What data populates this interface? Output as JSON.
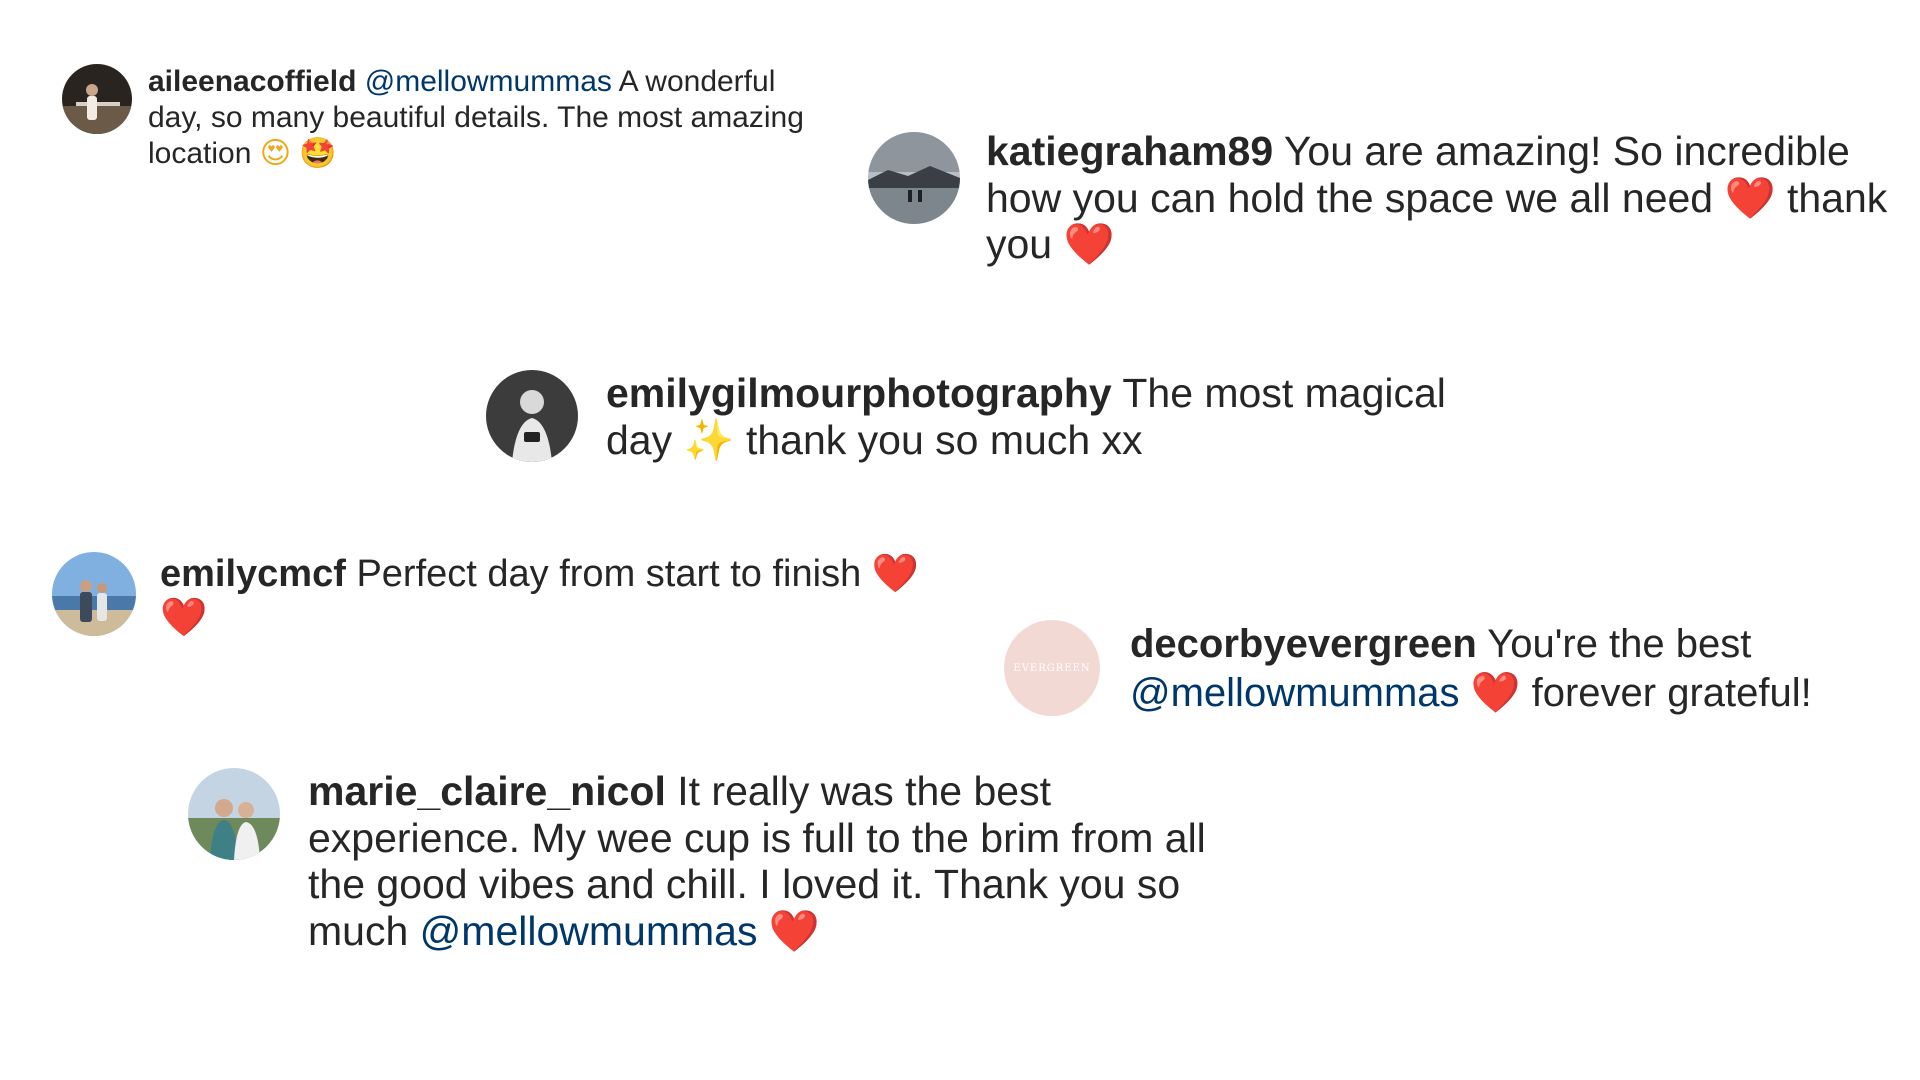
{
  "comments": [
    {
      "username": "aileenacoffield",
      "mention": "@mellowmummas",
      "text": "A wonderful day, so many beautiful details. The most amazing location",
      "emojis": [
        "😍",
        "🤩"
      ]
    },
    {
      "username": "katiegraham89",
      "text_1": "You are amazing! So incredible how you can hold the space we all need",
      "emoji_1": "❤️",
      "text_2": "thank you",
      "emoji_2": "❤️"
    },
    {
      "username": "emilygilmourphotography",
      "text_1": "The most magical day",
      "emoji_1": "✨",
      "text_2": "thank you so much xx"
    },
    {
      "username": "emilycmcf",
      "text": "Perfect day from start to finish",
      "emoji_1": "❤️",
      "emoji_2": "❤️"
    },
    {
      "username": "decorbyevergreen",
      "text_1": "You're the best",
      "mention": "@mellowmummas",
      "emoji": "❤️",
      "text_2": "forever grateful!",
      "avatar_text": "EVERGREEN"
    },
    {
      "username": "marie_claire_nicol",
      "text": "It really was the best experience. My wee cup is full to the brim from all the good vibes and chill. I loved it. Thank you so much",
      "mention": "@mellowmummas",
      "emoji": "❤️"
    }
  ],
  "colors": {
    "text": "#262626",
    "mention": "#00376b",
    "heart": "#e0141e",
    "background": "#ffffff"
  }
}
